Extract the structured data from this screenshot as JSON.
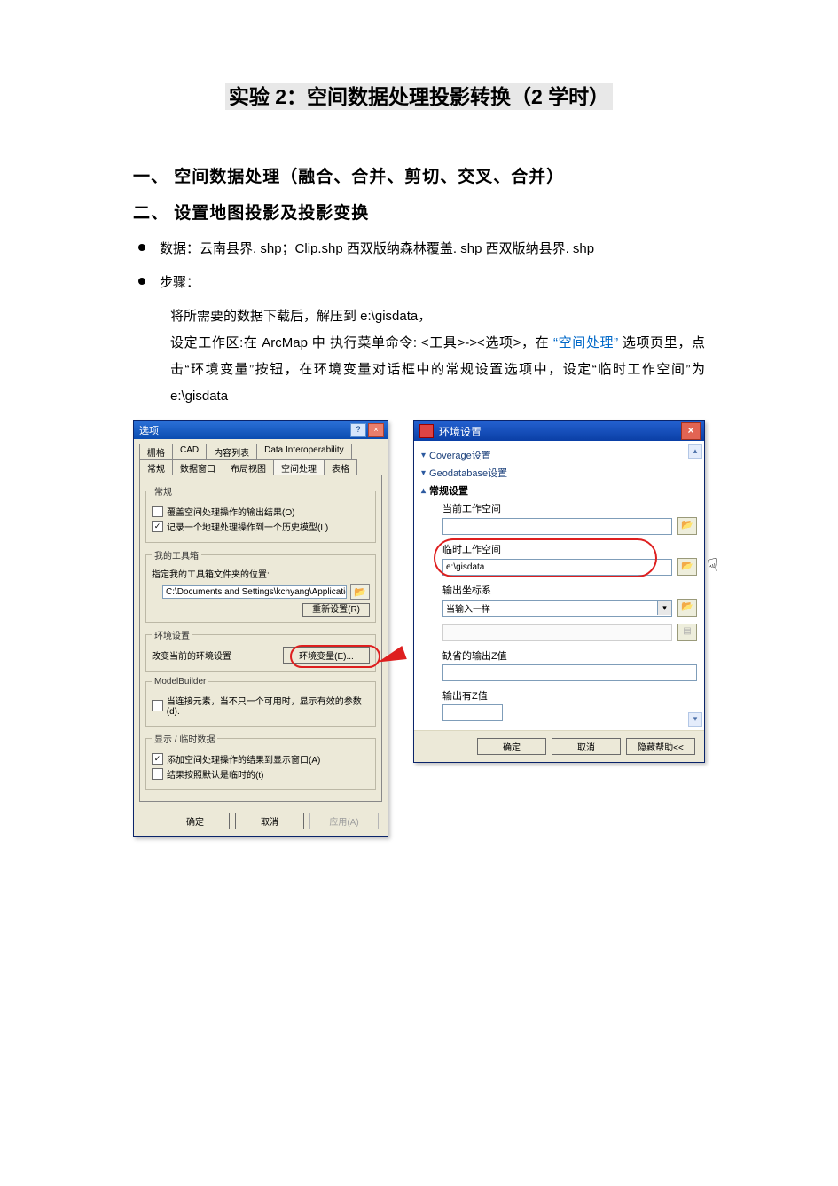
{
  "doc": {
    "title": "实验 2：空间数据处理投影转换（2 学时）",
    "section1": "一、 空间数据处理（融合、合并、剪切、交叉、合并）",
    "section2": "二、 设置地图投影及投影变换",
    "bullet_data_label": "数据：",
    "bullet_data_value": "云南县界. shp；Clip.shp 西双版纳森林覆盖. shp 西双版纳县界. shp",
    "bullet_steps_label": "步骤：",
    "step_line1": "将所需要的数据下载后，解压到 e:\\gisdata，",
    "step_line2a": "设定工作区:在 ArcMap 中 执行菜单命令: <工具>-><选项>，在",
    "step_line2b": "“空间处理”",
    "step_line2c": "选项页里，点击“环境变量”按钮，在环境变量对话框中的常规设置选项中，设定“临时工作空间”为 e:\\gisdata"
  },
  "dlg1": {
    "title": "选项",
    "help_btn": "?",
    "close_btn": "×",
    "tabs_row1": [
      "栅格",
      "CAD",
      "内容列表",
      "Data Interoperability"
    ],
    "tabs_row2": [
      "常规",
      "数据窗口",
      "布局视图",
      "空间处理",
      "表格"
    ],
    "active_tab": "空间处理",
    "group_general": "常规",
    "chk1_label": "覆盖空间处理操作的输出结果(O)",
    "chk2_label": "记录一个地理处理操作到一个历史模型(L)",
    "chk2_checked": "✓",
    "group_toolbox": "我的工具箱",
    "toolbox_desc": "指定我的工具箱文件夹的位置:",
    "toolbox_path": "C:\\Documents and Settings\\kchyang\\Application Data\\E",
    "reset_btn": "重新设置(R)",
    "group_env": "环境设置",
    "env_desc": "改变当前的环境设置",
    "env_btn": "环境变量(E)...",
    "group_mb": "ModelBuilder",
    "mb_chk_label": "当连接元素，当不只一个可用时，显示有效的参数(d).",
    "group_display": "显示 / 临时数据",
    "disp_chk1_label": "添加空间处理操作的结果到显示窗口(A)",
    "disp_chk1_checked": "✓",
    "disp_chk2_label": "结果按照默认是临时的(t)",
    "btn_ok": "确定",
    "btn_cancel": "取消",
    "btn_apply": "应用(A)"
  },
  "dlg2": {
    "title": "环境设置",
    "close_btn": "×",
    "sec_coverage": "Coverage设置",
    "sec_geodb": "Geodatabase设置",
    "sec_general": "常规设置",
    "lbl_current_ws": "当前工作空间",
    "lbl_temp_ws": "临时工作空间",
    "val_temp_ws": "e:\\gisdata",
    "lbl_out_coord": "输出坐标系",
    "val_out_coord": "当输入一样",
    "lbl_default_z": "缺省的输出Z值",
    "lbl_has_z": "输出有Z值",
    "btn_ok": "确定",
    "btn_cancel": "取消",
    "btn_hidehelp": "隐藏帮助<<"
  }
}
